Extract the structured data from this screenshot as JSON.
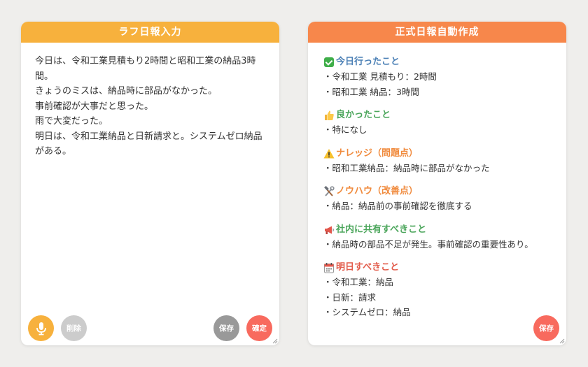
{
  "left_panel": {
    "title": "ラフ日報入力",
    "text": "今日は、令和工業見積もり2時間と昭和工業の納品3時間。\nきょうのミスは、納品時に部品がなかった。\n事前確認が大事だと思った。\n雨で大変だった。\n明日は、令和工業納品と日新請求と。システムゼロ納品がある。",
    "buttons": {
      "mic_icon": "microphone-icon",
      "delete": "削除",
      "save": "保存",
      "confirm": "確定"
    }
  },
  "right_panel": {
    "title": "正式日報自動作成",
    "sections": [
      {
        "icon": "check-mark-icon",
        "color": "#4a7fb5",
        "heading": "今日行ったこと",
        "items": [
          "・令和工業 見積もり：2時間",
          "・昭和工業 納品：3時間"
        ]
      },
      {
        "icon": "thumbs-up-icon",
        "color": "#4aa55a",
        "heading": "良かったこと",
        "items": [
          "・特になし"
        ]
      },
      {
        "icon": "warning-icon",
        "color": "#f08a3c",
        "heading": "ナレッジ（問題点）",
        "items": [
          "・昭和工業納品：納品時に部品がなかった"
        ]
      },
      {
        "icon": "hammer-wrench-icon",
        "color": "#f08a3c",
        "heading": "ノウハウ（改善点）",
        "items": [
          "・納品：納品前の事前確認を徹底する"
        ]
      },
      {
        "icon": "megaphone-icon",
        "color": "#4aa55a",
        "heading": "社内に共有すべきこと",
        "items": [
          "・納品時の部品不足が発生。事前確認の重要性あり。"
        ]
      },
      {
        "icon": "calendar-icon",
        "color": "#e25b4a",
        "heading": "明日すべきこと",
        "items": [
          "・令和工業：納品",
          "・日新：請求",
          "・システムゼロ：納品"
        ]
      }
    ],
    "buttons": {
      "save": "保存"
    }
  },
  "colors": {
    "left_header": "#f7b13d",
    "right_header": "#f7874b",
    "mic_button": "#f7b13d",
    "delete_button": "#cccccc",
    "save_button": "#999999",
    "confirm_button": "#f86a5e",
    "right_save_button": "#f86a5e"
  }
}
